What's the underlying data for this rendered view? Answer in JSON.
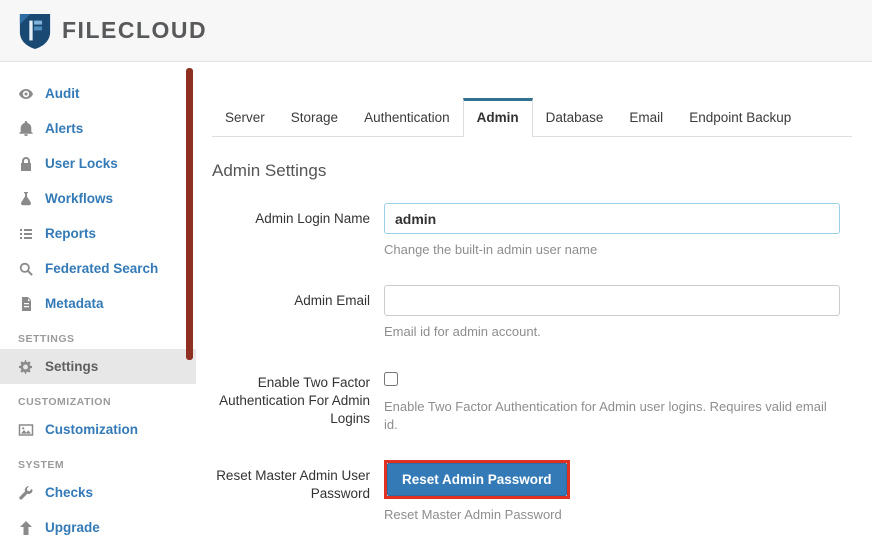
{
  "header": {
    "logo_text": "FILECLOUD"
  },
  "sidebar": {
    "items": [
      {
        "label": "Audit",
        "icon": "eye-icon"
      },
      {
        "label": "Alerts",
        "icon": "bell-icon"
      },
      {
        "label": "User Locks",
        "icon": "lock-icon"
      },
      {
        "label": "Workflows",
        "icon": "flask-icon"
      },
      {
        "label": "Reports",
        "icon": "list-icon"
      },
      {
        "label": "Federated Search",
        "icon": "search-icon"
      },
      {
        "label": "Metadata",
        "icon": "document-icon"
      }
    ],
    "sections": {
      "settings_header": "SETTINGS",
      "settings_item": {
        "label": "Settings",
        "icon": "gear-icon"
      },
      "customization_header": "CUSTOMIZATION",
      "customization_item": {
        "label": "Customization",
        "icon": "image-icon"
      },
      "system_header": "SYSTEM",
      "checks_item": {
        "label": "Checks",
        "icon": "wrench-icon"
      },
      "upgrade_item": {
        "label": "Upgrade",
        "icon": "arrow-up-icon"
      }
    }
  },
  "tabs": {
    "items": [
      "Server",
      "Storage",
      "Authentication",
      "Admin",
      "Database",
      "Email",
      "Endpoint Backup"
    ],
    "active": "Admin"
  },
  "main": {
    "title": "Admin Settings",
    "form": {
      "admin_login": {
        "label": "Admin Login Name",
        "value": "admin",
        "help": "Change the built-in admin user name"
      },
      "admin_email": {
        "label": "Admin Email",
        "value": "",
        "help": "Email id for admin account."
      },
      "two_factor": {
        "label": "Enable Two Factor Authentication For Admin Logins",
        "checked": false,
        "help": "Enable Two Factor Authentication for Admin user logins. Requires valid email id."
      },
      "reset_admin": {
        "label": "Reset Master Admin User Password",
        "button_label": "Reset Admin Password",
        "help": "Reset Master Admin Password"
      }
    }
  },
  "colors": {
    "accent": "#337ab7",
    "highlight_annotation": "#e03222",
    "tab_active_top": "#31708f",
    "sidebar_scrollbar": "#8e2f22"
  }
}
